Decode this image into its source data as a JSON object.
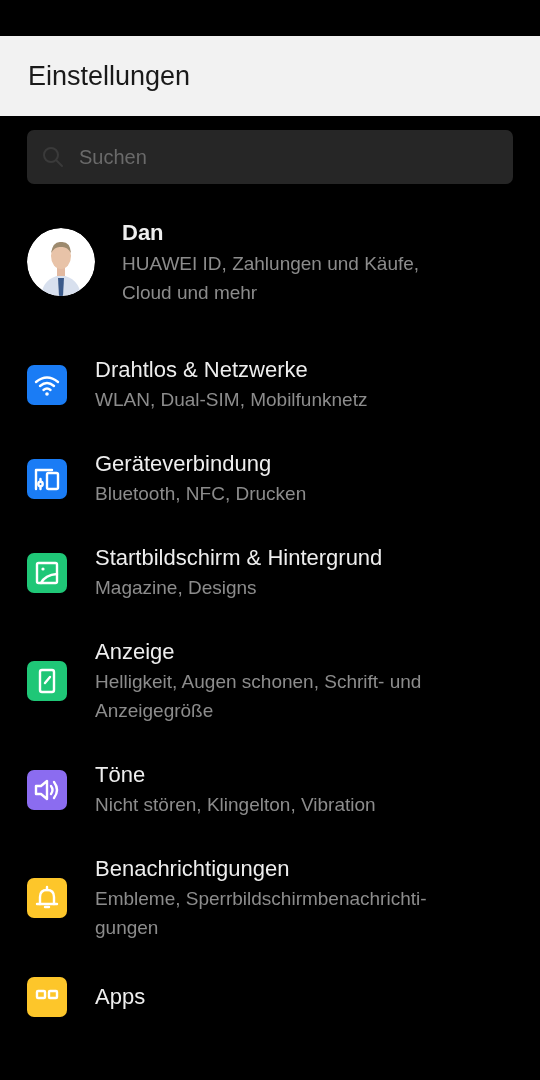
{
  "header": {
    "title": "Einstellungen"
  },
  "search": {
    "placeholder": "Suchen"
  },
  "account": {
    "name": "Dan",
    "subtitle": "HUAWEI ID, Zahlungen und Käufe, Cloud und mehr"
  },
  "items": [
    {
      "kind": "wifi",
      "color": "#1a7cf5",
      "title": "Drahtlos & Netzwerke",
      "subtitle": "WLAN, Dual-SIM, Mobilfunknetz"
    },
    {
      "kind": "devices",
      "color": "#1a7cf5",
      "title": "Geräteverbindung",
      "subtitle": "Bluetooth, NFC, Drucken"
    },
    {
      "kind": "wallpaper",
      "color": "#1fc777",
      "title": "Startbildschirm & Hintergrund",
      "subtitle": "Magazine, Designs"
    },
    {
      "kind": "display",
      "color": "#1fc777",
      "title": "Anzeige",
      "subtitle": "Helligkeit, Augen schonen, Schrift- und Anzeigegröße"
    },
    {
      "kind": "sound",
      "color": "#8b6cf0",
      "title": "Töne",
      "subtitle": "Nicht stören, Klingelton, Vibration"
    },
    {
      "kind": "bell",
      "color": "#fdc62a",
      "title": "Benachrichtigungen",
      "subtitle": "Embleme, Sperrbildschirmbenachrichti-gungen"
    },
    {
      "kind": "apps",
      "color": "#fdc62a",
      "title": "Apps"
    }
  ]
}
